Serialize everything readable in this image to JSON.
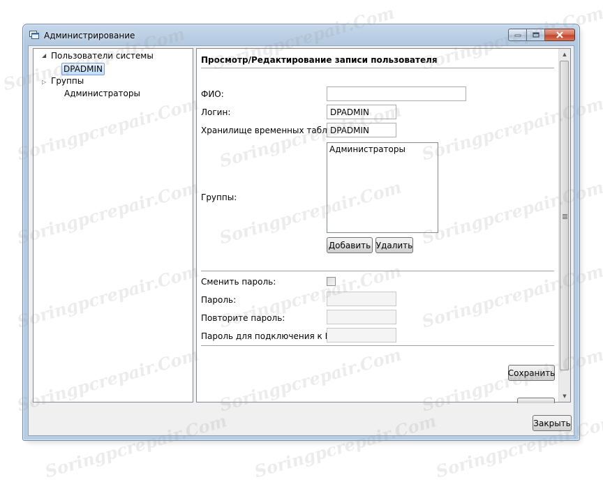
{
  "window": {
    "title": "Администрирование",
    "close_icon": "close-icon",
    "minimize_icon": "minimize-icon",
    "maximize_icon": "maximize-icon"
  },
  "tree": {
    "users_node": "Пользователи системы",
    "users_child": "DPADMIN",
    "groups_node": "Группы",
    "groups_child": "Администраторы"
  },
  "form": {
    "title": "Просмотр/Редактирование записи пользователя",
    "fio_label": "ФИО:",
    "fio_value": "",
    "login_label": "Логин:",
    "login_value": "DPADMIN",
    "temp_storage_label": "Хранилище временных таблиц:",
    "temp_storage_value": "DPADMIN",
    "groups_label": "Группы:",
    "groups_list": [
      "Администраторы"
    ],
    "add_button": "Добавить",
    "remove_button": "Удалить",
    "change_password_label": "Сменить пароль:",
    "change_password_checked": false,
    "password_label": "Пароль:",
    "repeat_password_label": "Повторите пароль:",
    "db_password_label": "Пароль для подключения к БД:",
    "save_button": "Сохранить"
  },
  "footer": {
    "close_button": "Закрыть"
  },
  "watermark": "Soringpcrepair.Com"
}
